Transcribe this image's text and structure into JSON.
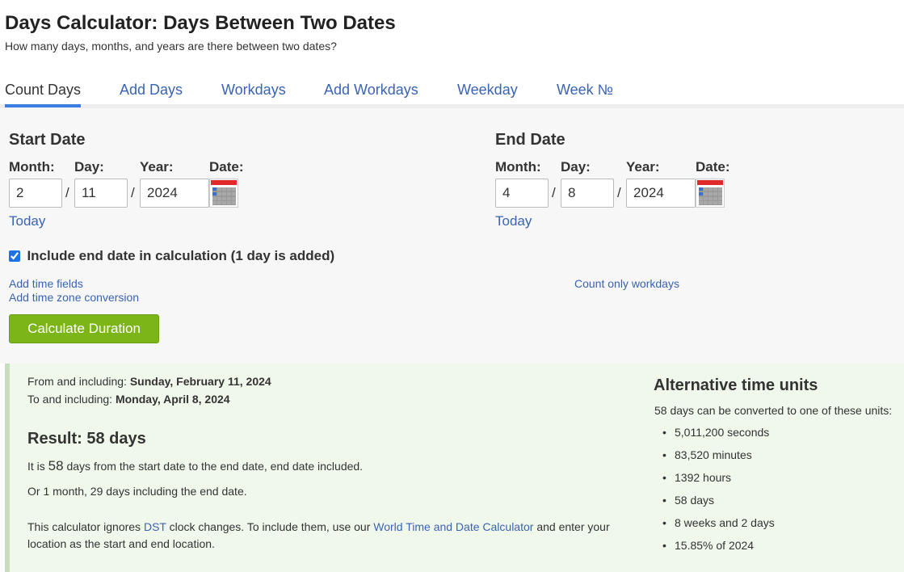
{
  "header": {
    "title": "Days Calculator: Days Between Two Dates",
    "subtitle": "How many days, months, and years are there between two dates?"
  },
  "tabs": [
    {
      "label": "Count Days",
      "active": true
    },
    {
      "label": "Add Days"
    },
    {
      "label": "Workdays"
    },
    {
      "label": "Add Workdays"
    },
    {
      "label": "Weekday"
    },
    {
      "label": "Week №"
    }
  ],
  "start": {
    "heading": "Start Date",
    "month_label": "Month:",
    "day_label": "Day:",
    "year_label": "Year:",
    "date_label": "Date:",
    "month": "2",
    "day": "11",
    "year": "2024",
    "today_link": "Today"
  },
  "end": {
    "heading": "End Date",
    "month_label": "Month:",
    "day_label": "Day:",
    "year_label": "Year:",
    "date_label": "Date:",
    "month": "4",
    "day": "8",
    "year": "2024",
    "today_link": "Today"
  },
  "separator": "/",
  "include_end": {
    "checked": true,
    "label": "Include end date in calculation (1 day is added)"
  },
  "links": {
    "add_time": "Add time fields",
    "add_timezone": "Add time zone conversion",
    "count_workdays": "Count only workdays"
  },
  "calculate_button": "Calculate Duration",
  "result": {
    "from_prefix": "From and including:",
    "from_value": "Sunday, February 11, 2024",
    "to_prefix": "To and including:",
    "to_value": "Monday, April 8, 2024",
    "heading": "Result: 58 days",
    "line1_pre": "It is",
    "line1_num": "58",
    "line1_post": "days from the start date to the end date, end date included.",
    "line2": "Or 1 month, 29 days including the end date.",
    "dst_pre": "This calculator ignores",
    "dst_link": "DST",
    "dst_mid": "clock changes. To include them, use our",
    "dst_link2": "World Time and Date Calculator",
    "dst_post": "and enter your",
    "dst_line2": "location as the start and end location."
  },
  "alternative": {
    "heading": "Alternative time units",
    "intro": "58 days can be converted to one of these units:",
    "items": [
      "5,011,200 seconds",
      "83,520 minutes",
      "1392 hours",
      "58 days",
      "8 weeks and 2 days",
      "15.85% of 2024"
    ]
  }
}
